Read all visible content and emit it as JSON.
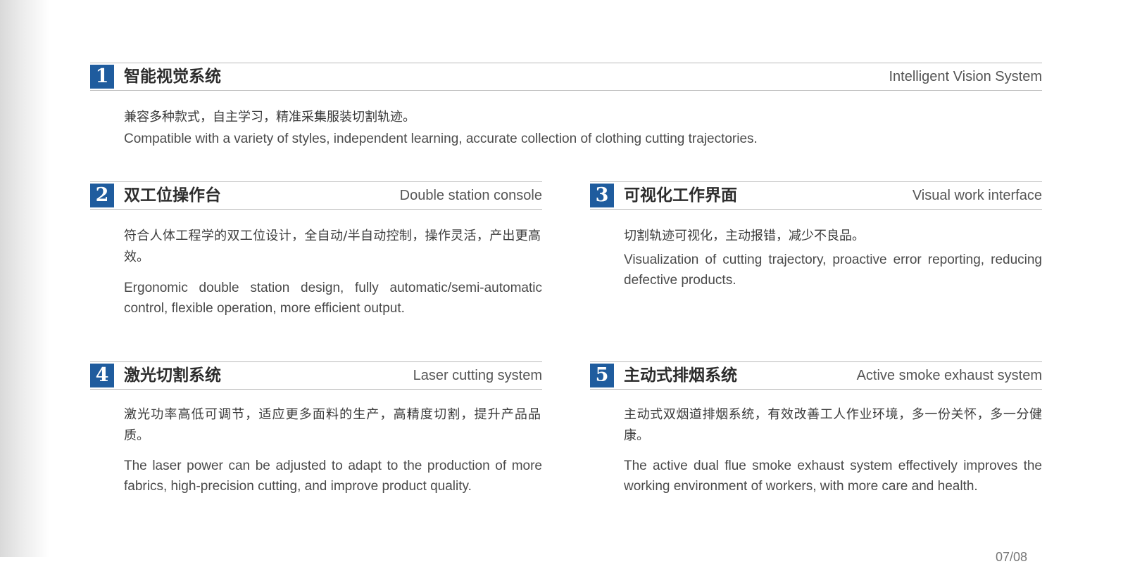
{
  "sections": [
    {
      "num": "1",
      "title_zh": "智能视觉系统",
      "title_en": "Intelligent Vision System",
      "desc_zh": "兼容多种款式，自主学习，精准采集服装切割轨迹。",
      "desc_en": "Compatible with a variety of styles, independent learning, accurate collection of clothing cutting trajectories."
    },
    {
      "num": "2",
      "title_zh": "双工位操作台",
      "title_en": "Double station console",
      "desc_zh": "符合人体工程学的双工位设计，全自动/半自动控制，操作灵活，产出更高效。",
      "desc_en": "Ergonomic double station design, fully automatic/semi-automatic control, flexible operation, more efficient output."
    },
    {
      "num": "3",
      "title_zh": "可视化工作界面",
      "title_en": "Visual work interface",
      "desc_zh": "切割轨迹可视化，主动报错，减少不良品。",
      "desc_en": "Visualization of cutting trajectory, proactive error reporting, reducing defective products."
    },
    {
      "num": "4",
      "title_zh": "激光切割系统",
      "title_en": "Laser cutting system",
      "desc_zh": "激光功率高低可调节，适应更多面料的生产，高精度切割，提升产品品质。",
      "desc_en": "The laser power can be adjusted to adapt to the production of more fabrics, high-precision cutting, and improve product quality."
    },
    {
      "num": "5",
      "title_zh": "主动式排烟系统",
      "title_en": "Active smoke exhaust system",
      "desc_zh": "主动式双烟道排烟系统，有效改善工人作业环境，多一份关怀，多一分健康。",
      "desc_en": "The active dual flue smoke exhaust system effectively improves the working environment of workers, with more care and health."
    }
  ],
  "colors": {
    "accent": "#1f5c9e",
    "rule": "#b9b9b9",
    "text": "#3a3a3a"
  },
  "page_number": "07/08"
}
